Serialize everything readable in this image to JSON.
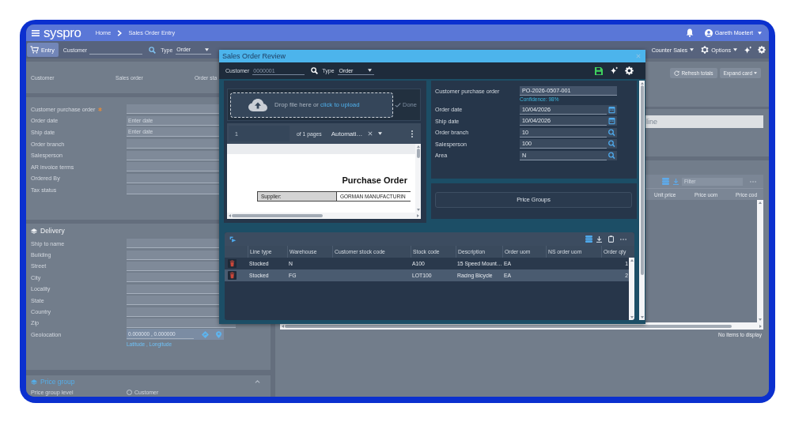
{
  "header": {
    "logo": "syspro",
    "breadcrumb": [
      "Home",
      "Sales Order Entry"
    ],
    "user": "Gareth Moetert"
  },
  "toolbar": {
    "entry": "Entry",
    "customer_label": "Customer",
    "type_label": "Type",
    "type_value": "Order",
    "menus": [
      {
        "label": "Counter Sales",
        "kind": "menu"
      },
      {
        "label": "Options",
        "kind": "settings_menu"
      }
    ]
  },
  "order_summary": {
    "columns": [
      "Customer",
      "Sales order",
      "Order sta"
    ]
  },
  "order_fields": [
    {
      "label": "Customer purchase order",
      "required": true
    },
    {
      "label": "Order date",
      "placeholder": "Enter date",
      "required": false
    },
    {
      "label": "Ship date",
      "placeholder": "Enter date",
      "required": false
    },
    {
      "label": "Order branch",
      "required": false
    },
    {
      "label": "Salesperson",
      "required": false
    },
    {
      "label": "AR invoice terms",
      "required": false
    },
    {
      "label": "Ordered By",
      "required": false
    },
    {
      "label": "Tax status",
      "required": false
    }
  ],
  "delivery": {
    "title": "Delivery",
    "fields": [
      {
        "label": "Ship to name"
      },
      {
        "label": "Building"
      },
      {
        "label": "Street"
      },
      {
        "label": "City"
      },
      {
        "label": "Locality"
      },
      {
        "label": "State"
      },
      {
        "label": "Country"
      },
      {
        "label": "Zip"
      }
    ],
    "geolocation": {
      "label": "Geolocation",
      "placeholder": "0.000000 , 0.000000",
      "hint": "Latitude , Longitude"
    }
  },
  "price_group": {
    "title": "Price group",
    "expanded": true,
    "level_label": "Price group level",
    "options": [
      {
        "label": "Customer",
        "selected": false
      }
    ]
  },
  "totals_card": {
    "actions": [
      {
        "label": "Refresh totals",
        "kind": "refresh"
      },
      {
        "label": "Expand card",
        "kind": "dropdown"
      }
    ]
  },
  "quick_entry": {
    "placeholder": "line"
  },
  "pricing_grid": {
    "filter_placeholder": "Filter",
    "columns": [
      "Unit price",
      "Price uom",
      "Price cod"
    ],
    "empty_message": "No items to display"
  },
  "dialog": {
    "title": "Sales Order Review",
    "customer": {
      "label": "Customer",
      "placeholder": "0000001"
    },
    "type": {
      "label": "Type",
      "value": "Order"
    },
    "upload": {
      "prompt": "Drop file here or",
      "link": "click to upload",
      "done": {
        "label": "Done",
        "disabled": true
      }
    },
    "viewer": {
      "page": "1",
      "page_count": "of 1 pages",
      "zoom": "Automati…",
      "document": {
        "title": "Purchase Order",
        "rows": [
          {
            "label": "Supplier:",
            "value": "GORMAN MANUFACTURIN"
          }
        ]
      }
    },
    "fields": [
      {
        "label": "Customer purchase order",
        "value": "PO-2026-0507-001",
        "kind": "text",
        "note": "Confidence: 98%"
      },
      {
        "label": "Order date",
        "value": "10/04/2026",
        "kind": "date"
      },
      {
        "label": "Ship date",
        "value": "10/04/2026",
        "kind": "date"
      },
      {
        "label": "Order branch",
        "value": "10",
        "kind": "lookup"
      },
      {
        "label": "Salesperson",
        "value": "100",
        "kind": "lookup"
      },
      {
        "label": "Area",
        "value": "N",
        "kind": "lookup"
      }
    ],
    "price_groups_button": "Price Groups",
    "lines": {
      "columns": [
        "Line type",
        "Warehouse",
        "Customer stock code",
        "Stock code",
        "Description",
        "Order uom",
        "NS order uom",
        "Order qty"
      ],
      "rows": [
        {
          "selected": false,
          "line_type": "Stocked",
          "warehouse": "N",
          "stock_code": "A100",
          "description": "15 Speed Mount…",
          "order_uom": "EA",
          "order_qty": "1"
        },
        {
          "selected": true,
          "line_type": "Stocked",
          "warehouse": "FG",
          "stock_code": "LOT100",
          "description": "Racing Bicycle",
          "order_uom": "EA",
          "order_qty": "2"
        }
      ]
    }
  }
}
